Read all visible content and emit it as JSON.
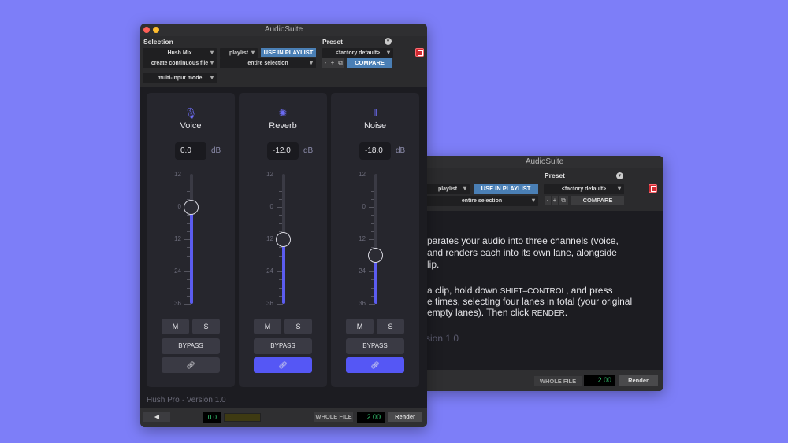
{
  "back": {
    "title": "AudioSuite",
    "preset_label": "Preset",
    "playlist": "playlist",
    "use_in_playlist": "USE IN PLAYLIST",
    "factory_default": "<factory default>",
    "entire_selection": "entire selection",
    "minus": "-",
    "plus": "+",
    "compare": "COMPARE",
    "desc_lines": [
      [
        "parates your audio into three channels (voice,"
      ],
      [
        "and renders each into its own lane, alongside"
      ],
      [
        "lip."
      ]
    ],
    "desc2_a": "a clip, hold down ",
    "desc2_sc": "SHIFT–CONTROL",
    "desc2_b": ", and press",
    "desc3": "e times, selecting four lanes in total (your original",
    "desc4_a": "empty lanes). Then click ",
    "desc4_sc": "RENDER",
    "desc4_b": ".",
    "version": "sion 1.0",
    "whole_file": "WHOLE FILE",
    "handle": "2.00",
    "render": "Render"
  },
  "front": {
    "title": "AudioSuite",
    "selection_label": "Selection",
    "preset_label": "Preset",
    "plugin": "Hush Mix",
    "playlist": "playlist",
    "use_in_playlist": "USE IN PLAYLIST",
    "factory_default": "<factory default>",
    "continuous": "create continuous file",
    "entire_selection": "entire selection",
    "minus": "-",
    "plus": "+",
    "compare": "COMPARE",
    "multi_input": "multi-input mode",
    "db_unit": "dB",
    "scale": [
      "12",
      "0",
      "12",
      "24",
      "36"
    ],
    "channels": [
      {
        "name": "Voice",
        "value": "0.0",
        "gain_db": 0,
        "mute": "M",
        "solo": "S",
        "bypass": "BYPASS",
        "link_active": false
      },
      {
        "name": "Reverb",
        "value": "-12.0",
        "gain_db": -12,
        "mute": "M",
        "solo": "S",
        "bypass": "BYPASS",
        "link_active": true
      },
      {
        "name": "Noise",
        "value": "-18.0",
        "gain_db": -18,
        "mute": "M",
        "solo": "S",
        "bypass": "BYPASS",
        "link_active": true
      }
    ],
    "version": "Hush Pro · Version 1.0",
    "meter": "0.0",
    "whole_file": "WHOLE FILE",
    "handle": "2.00",
    "render": "Render"
  }
}
